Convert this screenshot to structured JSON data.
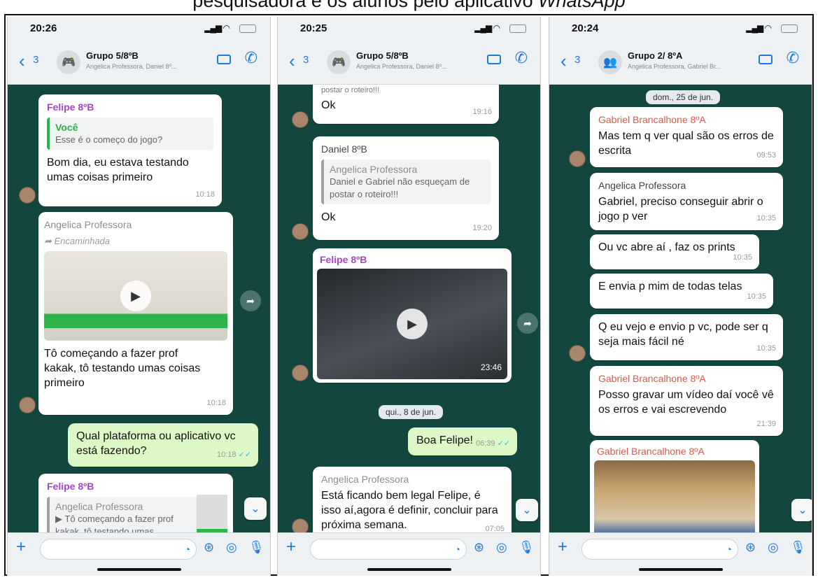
{
  "caption": {
    "prefix": "pesquisadora e os alunos pelo aplicativo ",
    "app": "WhatsApp"
  },
  "colors": {
    "chat_bg": "#12463f",
    "outgoing": "#dcf8c6",
    "accent": "#1f7ae0"
  },
  "screens": [
    {
      "time": "20:26",
      "back_count": "3",
      "group": "Grupo 5/8ºB",
      "subtitle": "Angelica Professora, Daniel 8º...",
      "avatar_icon": "gamepad-icon",
      "messages": {
        "m1": {
          "sender": "Felipe 8ºB",
          "quote_name": "Você",
          "quote_text": "Esse é o começo do jogo?",
          "text": "Bom dia, eu estava testando umas coisas primeiro",
          "time": "10:18"
        },
        "m2": {
          "sender": "Angelica Professora",
          "forwarded": "➦ Encaminhada",
          "text": "Tô começando a fazer prof kakak, tô testando umas coisas primeiro",
          "time": "10:18"
        },
        "m3": {
          "text": "Qual plataforma ou aplicativo vc está fazendo?",
          "time": "10:18",
          "ticks": "✓✓"
        },
        "m4": {
          "sender": "Felipe 8ºB",
          "quote_name": "Angelica Professora",
          "quote_text": "▶ Tô começando a fazer prof kakak, tô testando umas"
        }
      }
    },
    {
      "time": "20:25",
      "back_count": "3",
      "group": "Grupo 5/8ºB",
      "subtitle": "Angelica Professora, Daniel 8º...",
      "avatar_icon": "gamepad-icon",
      "messages": {
        "m0_tail": "postar o roteiro!!!",
        "m1": {
          "text": "Ok",
          "time": "19:16"
        },
        "m2": {
          "sender": "Daniel 8ºB",
          "quote_name": "Angelica Professora",
          "quote_text": "Daniel e Gabriel não esqueçam de postar o roteiro!!!",
          "text": "Ok",
          "time": "19:20"
        },
        "m3": {
          "sender": "Felipe 8ºB",
          "duration": "23:46"
        },
        "date_chip": "qui., 8 de jun.",
        "m4": {
          "text": "Boa Felipe!",
          "time": "06:39",
          "ticks": "✓✓"
        },
        "m5": {
          "sender": "Angelica Professora",
          "text": "Está ficando bem legal Felipe, é isso aí,agora é definir, concluir para próxima semana.",
          "time": "07:05"
        }
      }
    },
    {
      "time": "20:24",
      "back_count": "3",
      "group": "Grupo 2/ 8ºA",
      "subtitle": "Angelica Professora, Gabriel Br...",
      "avatar_icon": "group-icon",
      "messages": {
        "date_chip": "dom., 25 de jun.",
        "m1": {
          "sender": "Gabriel Brancalhone 8ºA",
          "text": "Mas tem q ver qual são os erros de escrita",
          "time": "09:53"
        },
        "m2": {
          "sender": "Angelica Professora",
          "text": "Gabriel, preciso conseguir abrir o jogo p ver",
          "time": "10:35"
        },
        "m3": {
          "text": "Ou vc abre aí , faz os prints",
          "time": "10:35"
        },
        "m4": {
          "text": "E envia p mim de todas telas",
          "time": "10:35"
        },
        "m5": {
          "text": "Q eu vejo e envio p vc, pode ser q seja mais fácil né",
          "time": "10:35"
        },
        "m6": {
          "sender": "Gabriel Brancalhone 8ºA",
          "text": "Posso gravar um vídeo daí você vê os erros e vai escrevendo",
          "time": "21:39"
        },
        "m7": {
          "sender": "Gabriel Brancalhone 8ºA"
        }
      }
    }
  ]
}
